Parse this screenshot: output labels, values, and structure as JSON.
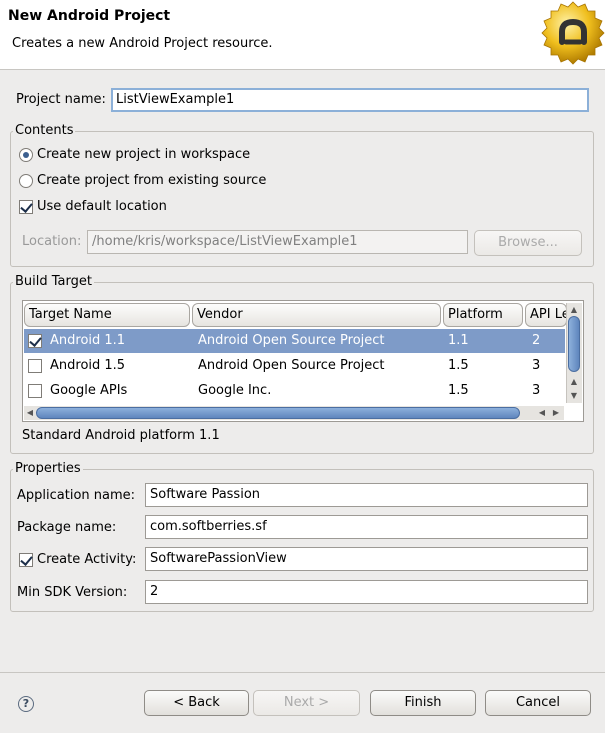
{
  "banner": {
    "title": "New Android Project",
    "description": "Creates a new Android Project resource."
  },
  "project": {
    "name_label": "Project name:",
    "name_value": "ListViewExample1"
  },
  "contents": {
    "title": "Contents",
    "option_new": "Create new project in workspace",
    "option_existing": "Create project from existing source",
    "use_default": "Use default location",
    "location_label": "Location:",
    "location_value": "/home/kris/workspace/ListViewExample1",
    "browse_label": "Browse..."
  },
  "build_target": {
    "title": "Build Target",
    "columns": [
      "Target Name",
      "Vendor",
      "Platform",
      "API Le"
    ],
    "rows": [
      {
        "name": "Android 1.1",
        "vendor": "Android Open Source Project",
        "platform": "1.1",
        "api": "2",
        "checked": true,
        "selected": true
      },
      {
        "name": "Android 1.5",
        "vendor": "Android Open Source Project",
        "platform": "1.5",
        "api": "3",
        "checked": false,
        "selected": false
      },
      {
        "name": "Google APIs",
        "vendor": "Google Inc.",
        "platform": "1.5",
        "api": "3",
        "checked": false,
        "selected": false
      }
    ],
    "description": "Standard Android platform 1.1"
  },
  "properties": {
    "title": "Properties",
    "app_name_label": "Application name:",
    "app_name_value": "Software Passion",
    "package_label": "Package name:",
    "package_value": "com.softberries.sf",
    "activity_label": "Create Activity:",
    "activity_value": "SoftwarePassionView",
    "min_sdk_label": "Min SDK Version:",
    "min_sdk_value": "2"
  },
  "buttons": {
    "help": "?",
    "back": "< Back",
    "next": "Next >",
    "finish": "Finish",
    "cancel": "Cancel"
  },
  "colors": {
    "selection": "#7e9bc8",
    "scroll_thumb": "#5f86bd",
    "logo_gold": "#e8b000"
  }
}
